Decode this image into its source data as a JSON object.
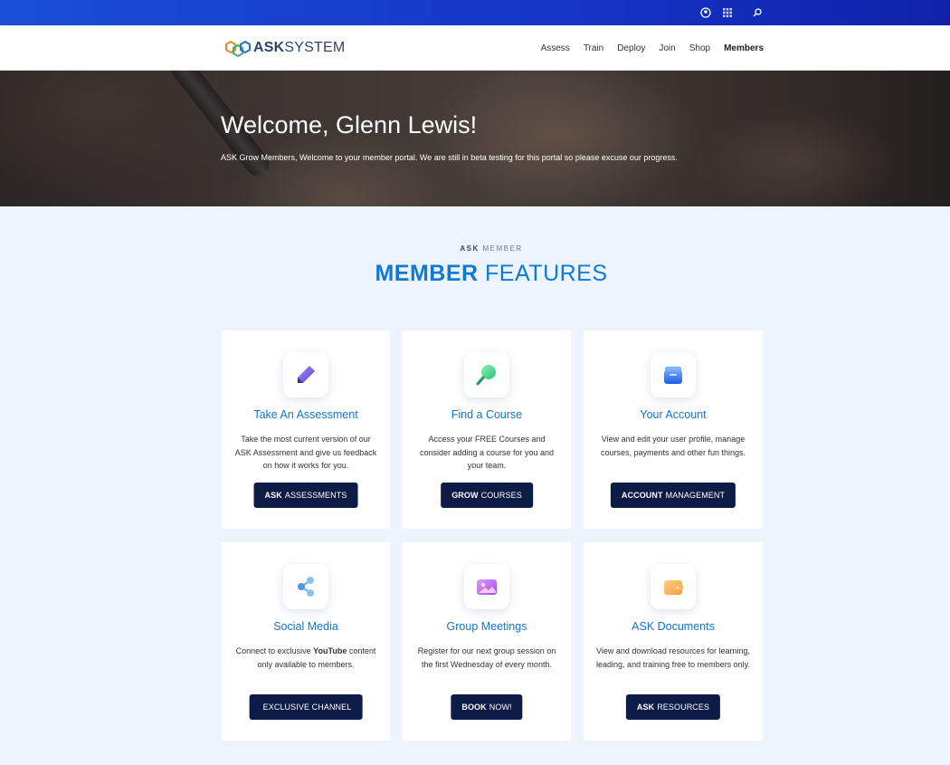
{
  "topbar": {
    "icons": [
      "user-circle-icon",
      "grid-icon",
      "search-icon"
    ]
  },
  "header": {
    "logo": {
      "brand_bold": "ASK",
      "brand_light": "SYSTEM"
    },
    "nav": [
      {
        "label": "Assess",
        "active": false
      },
      {
        "label": "Train",
        "active": false
      },
      {
        "label": "Deploy",
        "active": false
      },
      {
        "label": "Join",
        "active": false
      },
      {
        "label": "Shop",
        "active": false
      },
      {
        "label": "Members",
        "active": true
      }
    ]
  },
  "hero": {
    "title": "Welcome, Glenn Lewis!",
    "subtitle": "ASK Grow Members, Welcome to your member portal. We are still in beta testing for this portal so please excuse our progress."
  },
  "section": {
    "eyebrow_bold": "ASK",
    "eyebrow_light": "MEMBER",
    "title_bold": "MEMBER",
    "title_light": "FEATURES"
  },
  "cards": [
    {
      "icon": "pencil-icon",
      "title": "Take An Assessment",
      "desc_before": "Take the most current version of our ASK Assessment and give us feedback on how it works for you.",
      "desc_bold": "",
      "desc_after": "",
      "btn_bold": "ASK",
      "btn_light": "ASSESSMENTS"
    },
    {
      "icon": "magnifier-icon",
      "title": "Find a Course",
      "desc_before": "Access your FREE Courses and consider adding a course for you and your team.",
      "desc_bold": "",
      "desc_after": "",
      "btn_bold": "GROW",
      "btn_light": "COURSES"
    },
    {
      "icon": "inbox-icon",
      "title": "Your Account",
      "desc_before": "View and edit your user profile, manage courses, payments and other fun things.",
      "desc_bold": "",
      "desc_after": "",
      "btn_bold": "ACCOUNT",
      "btn_light": "MANAGEMENT"
    },
    {
      "icon": "share-icon",
      "title": "Social Media",
      "desc_before": "Connect to exclusive ",
      "desc_bold": "YouTube",
      "desc_after": " content only available to members.",
      "btn_bold": "",
      "btn_light": "EXCLUSIVE CHANNEL"
    },
    {
      "icon": "image-icon",
      "title": "Group Meetings",
      "desc_before": "Register for our next group session on the first Wednesday of every month.",
      "desc_bold": "",
      "desc_after": "",
      "btn_bold": "BOOK",
      "btn_light": "NOW!"
    },
    {
      "icon": "wallet-icon",
      "title": "ASK Documents",
      "desc_before": "View and download resources for learning, leading, and training free to members only.",
      "desc_bold": "",
      "desc_after": "",
      "btn_bold": "ASK",
      "btn_light": "RESOURCES"
    }
  ],
  "colors": {
    "topbar": "#1634c6",
    "accent": "#0e7ad8",
    "button": "#0d1c46",
    "page_bg": "#eef4fd"
  }
}
